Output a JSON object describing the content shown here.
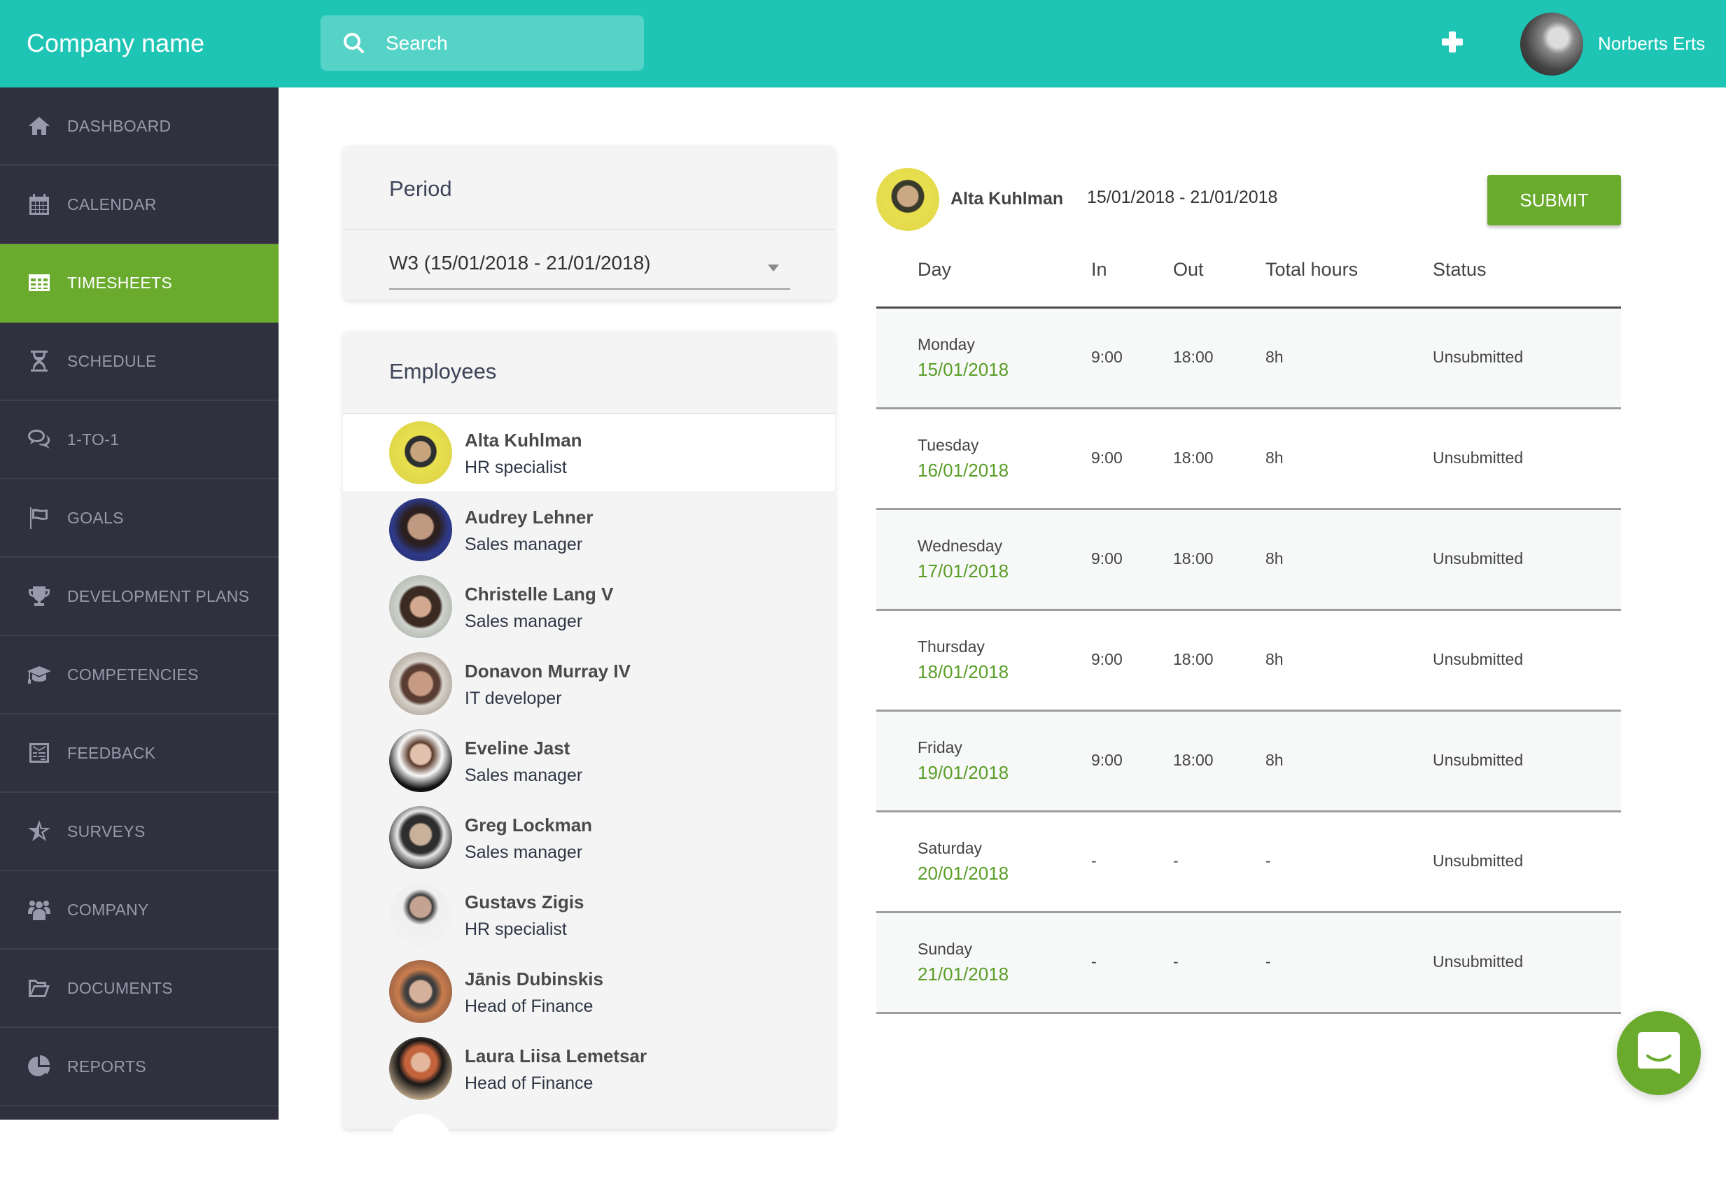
{
  "header": {
    "company_name": "Company name",
    "search_placeholder": "Search",
    "add_icon": "plus-icon",
    "user_name": "Norberts Erts"
  },
  "sidebar": {
    "items": [
      {
        "label": "DASHBOARD",
        "icon": "home-icon",
        "active": false
      },
      {
        "label": "CALENDAR",
        "icon": "calendar-icon",
        "active": false
      },
      {
        "label": "TIMESHEETS",
        "icon": "table-icon",
        "active": true
      },
      {
        "label": "SCHEDULE",
        "icon": "hourglass-icon",
        "active": false
      },
      {
        "label": "1-TO-1",
        "icon": "chat-bubbles-icon",
        "active": false
      },
      {
        "label": "GOALS",
        "icon": "flag-icon",
        "active": false
      },
      {
        "label": "DEVELOPMENT PLANS",
        "icon": "trophy-icon",
        "active": false
      },
      {
        "label": "COMPETENCIES",
        "icon": "graduation-cap-icon",
        "active": false
      },
      {
        "label": "FEEDBACK",
        "icon": "feedback-form-icon",
        "active": false
      },
      {
        "label": "SURVEYS",
        "icon": "star-half-icon",
        "active": false
      },
      {
        "label": "COMPANY",
        "icon": "users-icon",
        "active": false
      },
      {
        "label": "DOCUMENTS",
        "icon": "folder-open-icon",
        "active": false
      },
      {
        "label": "REPORTS",
        "icon": "pie-chart-icon",
        "active": false
      }
    ]
  },
  "period": {
    "title": "Period",
    "selected": "W3 (15/01/2018 - 21/01/2018)"
  },
  "employees": {
    "title": "Employees",
    "list": [
      {
        "name": "Alta Kuhlman",
        "role": "HR specialist",
        "selected": true
      },
      {
        "name": "Audrey Lehner",
        "role": "Sales manager",
        "selected": false
      },
      {
        "name": "Christelle Lang V",
        "role": "Sales manager",
        "selected": false
      },
      {
        "name": "Donavon Murray IV",
        "role": "IT developer",
        "selected": false
      },
      {
        "name": "Eveline Jast",
        "role": "Sales manager",
        "selected": false
      },
      {
        "name": "Greg Lockman",
        "role": "Sales manager",
        "selected": false
      },
      {
        "name": "Gustavs Zigis",
        "role": "HR specialist",
        "selected": false
      },
      {
        "name": "Jānis Dubinskis",
        "role": "Head of Finance",
        "selected": false
      },
      {
        "name": "Laura Liisa Lemetsar",
        "role": "Head of Finance",
        "selected": false
      },
      {
        "name": "",
        "role": "",
        "selected": false
      }
    ]
  },
  "timesheet": {
    "employee_name": "Alta Kuhlman",
    "date_range": "15/01/2018 - 21/01/2018",
    "submit_label": "SUBMIT",
    "columns": [
      "Day",
      "In",
      "Out",
      "Total hours",
      "Status"
    ],
    "rows": [
      {
        "day": "Monday",
        "date": "15/01/2018",
        "in": "9:00",
        "out": "18:00",
        "total": "8h",
        "status": "Unsubmitted"
      },
      {
        "day": "Tuesday",
        "date": "16/01/2018",
        "in": "9:00",
        "out": "18:00",
        "total": "8h",
        "status": "Unsubmitted"
      },
      {
        "day": "Wednesday",
        "date": "17/01/2018",
        "in": "9:00",
        "out": "18:00",
        "total": "8h",
        "status": "Unsubmitted"
      },
      {
        "day": "Thursday",
        "date": "18/01/2018",
        "in": "9:00",
        "out": "18:00",
        "total": "8h",
        "status": "Unsubmitted"
      },
      {
        "day": "Friday",
        "date": "19/01/2018",
        "in": "9:00",
        "out": "18:00",
        "total": "8h",
        "status": "Unsubmitted"
      },
      {
        "day": "Saturday",
        "date": "20/01/2018",
        "in": "-",
        "out": "-",
        "total": "-",
        "status": "Unsubmitted"
      },
      {
        "day": "Sunday",
        "date": "21/01/2018",
        "in": "-",
        "out": "-",
        "total": "-",
        "status": "Unsubmitted"
      }
    ]
  },
  "chat_widget": {
    "icon": "chat-smile-icon"
  },
  "colors": {
    "header_teal": "#1ec5b5",
    "sidebar_bg": "#30303e",
    "accent_green": "#6aab2e",
    "date_green": "#5a9e29"
  }
}
